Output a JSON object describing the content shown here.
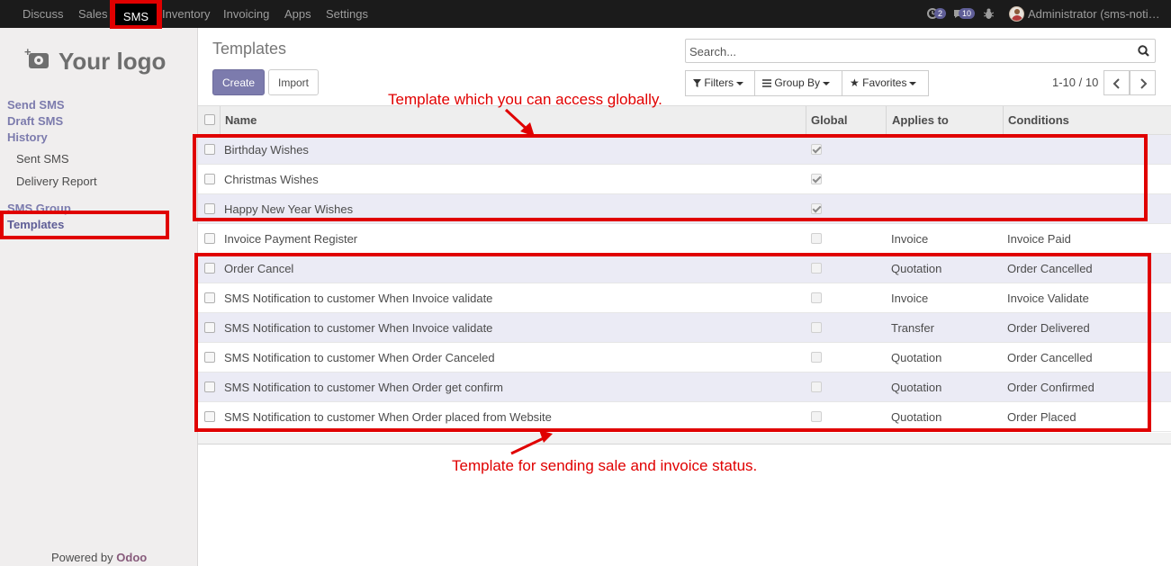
{
  "topbar": {
    "menu": [
      "Discuss",
      "Sales",
      "SMS",
      "Inventory",
      "Invoicing",
      "Apps",
      "Settings"
    ],
    "activities_count": "2",
    "messages_count": "10",
    "user": "Administrator (sms-noti…"
  },
  "sidebar": {
    "logo_text": "Your logo",
    "links": [
      "Send SMS",
      "Draft SMS",
      "History"
    ],
    "history_items": [
      "Sent SMS",
      "Delivery Report"
    ],
    "sms_group": "SMS Group",
    "templates": "Templates",
    "powered_prefix": "Powered by ",
    "powered_brand": "Odoo"
  },
  "control_panel": {
    "title": "Templates",
    "create_label": "Create",
    "import_label": "Import",
    "search_placeholder": "Search...",
    "filters_label": "Filters",
    "group_by_label": "Group By",
    "favorites_label": "Favorites",
    "pager": "1-10 / 10"
  },
  "table": {
    "columns": [
      "Name",
      "Global",
      "Applies to",
      "Conditions"
    ],
    "rows": [
      {
        "name": "Birthday Wishes",
        "global": true,
        "applies_to": "",
        "conditions": ""
      },
      {
        "name": "Christmas Wishes",
        "global": true,
        "applies_to": "",
        "conditions": ""
      },
      {
        "name": "Happy New Year Wishes",
        "global": true,
        "applies_to": "",
        "conditions": ""
      },
      {
        "name": "Invoice Payment Register",
        "global": false,
        "applies_to": "Invoice",
        "conditions": "Invoice Paid"
      },
      {
        "name": "Order Cancel",
        "global": false,
        "applies_to": "Quotation",
        "conditions": "Order Cancelled"
      },
      {
        "name": "SMS Notification to customer When Invoice validate",
        "global": false,
        "applies_to": "Invoice",
        "conditions": "Invoice Validate"
      },
      {
        "name": "SMS Notification to customer When Invoice validate",
        "global": false,
        "applies_to": "Transfer",
        "conditions": "Order Delivered"
      },
      {
        "name": "SMS Notification to customer When Order Canceled",
        "global": false,
        "applies_to": "Quotation",
        "conditions": "Order Cancelled"
      },
      {
        "name": "SMS Notification to customer When Order get confirm",
        "global": false,
        "applies_to": "Quotation",
        "conditions": "Order Confirmed"
      },
      {
        "name": "SMS Notification to customer When Order placed from Website",
        "global": false,
        "applies_to": "Quotation",
        "conditions": "Order Placed"
      }
    ]
  },
  "annotations": {
    "global_note": "Template which you can access globally.",
    "status_note": "Template for sending sale and invoice status.",
    "color": "#e00000"
  },
  "colors": {
    "brand": "#7c7bad",
    "topbar": "#1b1b1b",
    "odoo": "#875a7b"
  }
}
